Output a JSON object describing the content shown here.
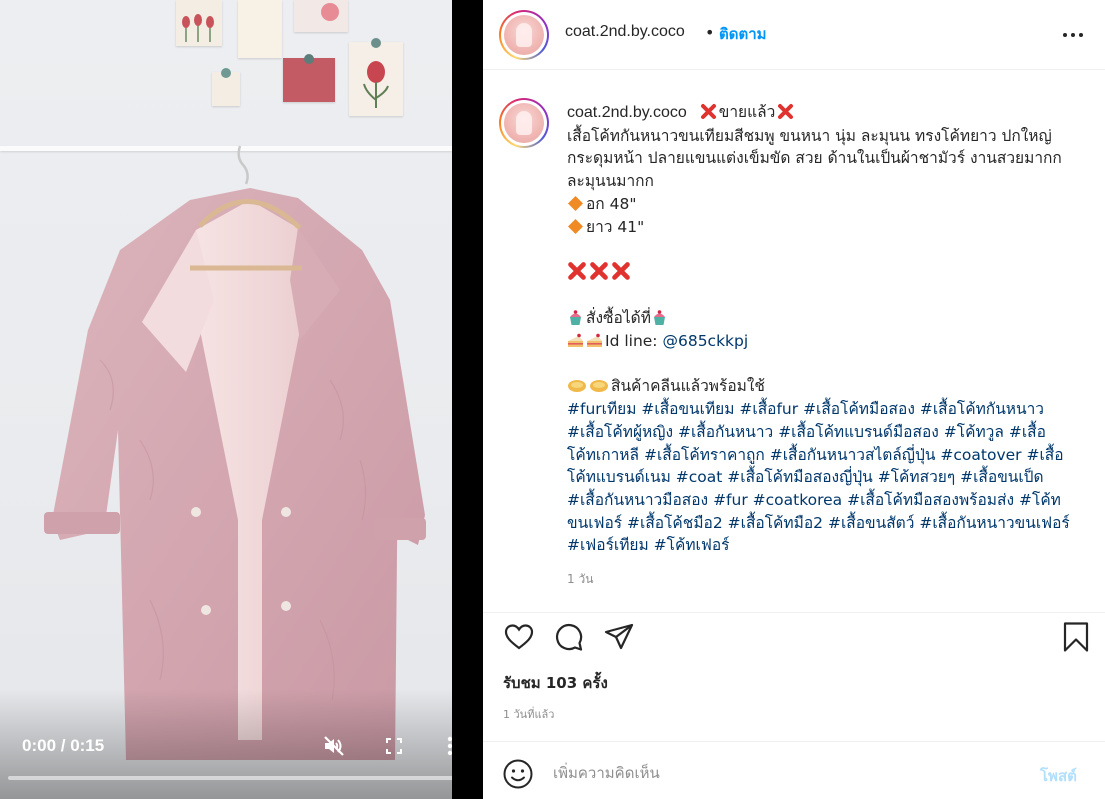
{
  "video": {
    "time_display": "0:00 / 0:15",
    "progress_fraction": 0,
    "mute_icon": "muted-speaker-icon",
    "fullscreen_icon": "fullscreen-icon",
    "more_icon": "vertical-dots-icon"
  },
  "header": {
    "username": "coat.2nd.by.coco",
    "separator": "•",
    "follow_label": "ติดตาม",
    "more_icon": "horizontal-dots-icon"
  },
  "caption": {
    "username": "coat.2nd.by.coco",
    "title_text": "ขายแล้ว",
    "lines": [
      "เสื้อโค้ทกันหนาวขนเทียมสีชมพู ขนหนา นุ่ม ละมุนน ทรงโค้ทยาว ปกใหญ่",
      "กระดุมหน้า ปลายแขนแต่งเข็มขัด สวย ด้านในเป็นผ้าชามัวร์ งานสวยมากก",
      "ละมุนนมากก"
    ],
    "chest": "อก 48\"",
    "length": "ยาว 41\"",
    "order_text": "สั่งซื้อได้ที่",
    "line_id_label": "Id line: ",
    "line_id": "@685ckkpj",
    "clean_text": "สินค้าคลีนแล้วพร้อมใช้",
    "hashtag_lines": [
      [
        "#furเทียม",
        "#เสื้อขนเทียม",
        "#เสื้อfur",
        "#เสื้อโค้ทมือสอง",
        "#เสื้อโค้ทกันหนาว"
      ],
      [
        "#เสื้อโค้ทผู้หญิง",
        "#เสื้อกันหนาว",
        "#เสื้อโค้ทแบรนด์มือสอง",
        "#โค้ทวูล",
        "#เสื้อ"
      ],
      [
        "โค้ทเกาหลี",
        "#เสื้อโค้ทราคาถูก",
        "#เสื้อกันหนาวสไตล์ญี่ปุ่น",
        "#coatover",
        "#เสื้อ"
      ],
      [
        "โค้ทแบรนด์เนม",
        "#coat",
        "#เสื้อโค้ทมือสองญี่ปุ่น",
        "#โค้ทสวยๆ",
        "#เสื้อขนเป็ด"
      ],
      [
        "#เสื้อกันหนาวมือสอง",
        "#fur",
        "#coatkorea",
        "#เสื้อโค้ทมือสองพร้อมส่ง",
        "#โค้ท"
      ],
      [
        "ขนเฟอร์",
        "#เสื้อโค้ชมือ2",
        "#เสื้อโค้ทมือ2",
        "#เสื้อขนสัตว์",
        "#เสื้อกันหนาวขนเฟอร์"
      ],
      [
        "#เฟอร์เทียม",
        "#โค้ทเฟอร์"
      ]
    ],
    "time_ago": "1 วัน"
  },
  "actions": {
    "like_icon": "heart-icon",
    "comment_icon": "comment-bubble-icon",
    "share_icon": "paper-plane-icon",
    "save_icon": "bookmark-icon",
    "views_text": "รับชม 103 ครั้ง",
    "date_text": "1 วันที่แล้ว"
  },
  "comment": {
    "placeholder": "เพิ่มความคิดเห็น",
    "post_label": "โพสต์",
    "emoji_icon": "smiley-icon"
  },
  "colors": {
    "link": "#00376b",
    "follow": "#0095f6",
    "post_disabled": "#b2dffc",
    "muted_text": "#8e8e8e",
    "coat_pink": "#d9aeb6"
  }
}
